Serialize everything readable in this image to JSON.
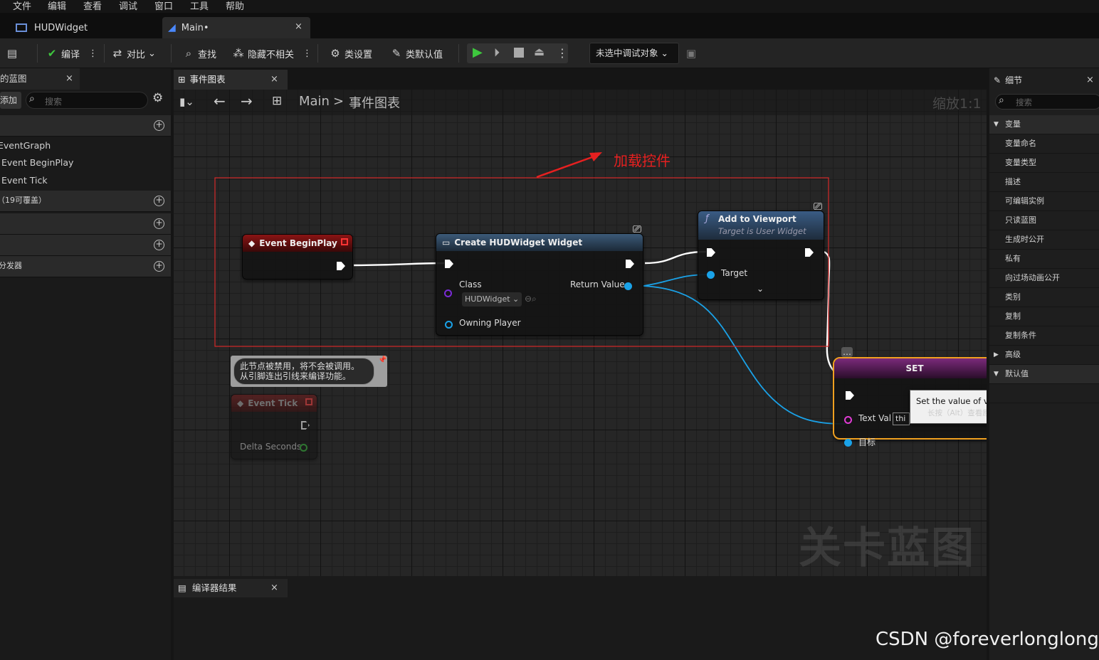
{
  "menu": [
    "文件",
    "编辑",
    "查看",
    "调试",
    "窗口",
    "工具",
    "帮助"
  ],
  "tabs": [
    {
      "label": "HUDWidget"
    },
    {
      "label": "Main•"
    }
  ],
  "toolbar": {
    "save_tooltip": "",
    "compile": "编译",
    "diff": "对比",
    "find": "查找",
    "hide_unrelated": "隐藏不相关",
    "class_settings": "类设置",
    "class_defaults": "类默认值",
    "debug_object": "未选中调试对象"
  },
  "left_panel": {
    "title": "的蓝图",
    "add": "添加",
    "search_placeholder": "搜索",
    "items": [
      "EventGraph",
      "Event BeginPlay",
      "Event Tick"
    ],
    "section_override": "（19可覆盖）",
    "section_dispatchers": "分发器"
  },
  "graph_tab": {
    "label": "事件图表"
  },
  "breadcrumb": {
    "root": "Main",
    "sep": ">",
    "leaf": "事件图表"
  },
  "zoom": "缩放1:1",
  "annotation": {
    "text": "加载控件",
    "color": "#e62020"
  },
  "nodes": {
    "begin_play": {
      "title": "Event BeginPlay"
    },
    "create_widget": {
      "title": "Create HUDWidget Widget",
      "class_label": "Class",
      "class_value": "HUDWidget",
      "return_label": "Return Value",
      "owning_player": "Owning Player"
    },
    "add_to_viewport": {
      "title": "Add to Viewport",
      "subtitle": "Target is User Widget",
      "target": "Target"
    },
    "event_tick": {
      "title": "Event Tick",
      "delta": "Delta Seconds",
      "disabled_comment_1": "此节点被禁用，将不会被调用。",
      "disabled_comment_2": "从引脚连出引线来编译功能。"
    },
    "set": {
      "title": "SET",
      "text_val": "Text Val",
      "text_val_input": "thi",
      "target": "目标",
      "tooltip": "Set the value of variable text_val",
      "tooltip_hint": "长按（Alt）查看原生节点命名"
    }
  },
  "watermark": "关卡蓝图",
  "bottom_panel": {
    "tab": "编译器结果"
  },
  "right_panel": {
    "title": "细节",
    "search_placeholder": "搜索",
    "section_variable": "变量",
    "rows": [
      "变量命名",
      "变量类型",
      "描述",
      "可编辑实例",
      "只读蓝图",
      "生成时公开",
      "私有",
      "向过场动画公开",
      "类别",
      "复制",
      "复制条件"
    ],
    "section_advanced": "高级",
    "section_default": "默认值"
  },
  "credit": "CSDN @foreverlonglong",
  "colors": {
    "exec": "#ffffff",
    "object_pin": "#1aa2e8",
    "class_pin": "#7a2bd6",
    "text_pin": "#e03cd4",
    "float_pin": "#36b83a",
    "set_border": "#f0a020"
  }
}
